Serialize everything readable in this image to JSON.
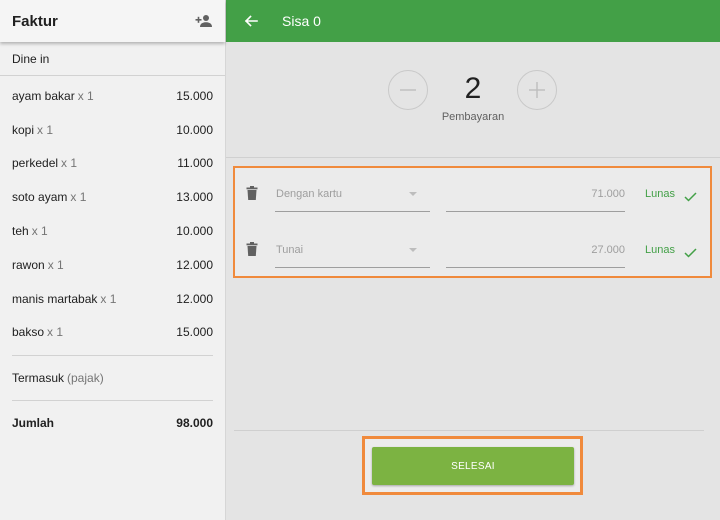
{
  "colors": {
    "topbar": "#43a047",
    "finish_button": "#7cb342",
    "highlight_border": "#f08a3c",
    "paid_status": "#43a047"
  },
  "invoice": {
    "title": "Faktur",
    "add_customer_icon": "person-add-icon",
    "order_type": "Dine in",
    "items": [
      {
        "name": "ayam bakar",
        "qty": "x 1",
        "price": "15.000"
      },
      {
        "name": "kopi",
        "qty": "x 1",
        "price": "10.000"
      },
      {
        "name": "perkedel",
        "qty": "x 1",
        "price": "11.000"
      },
      {
        "name": "soto ayam",
        "qty": "x 1",
        "price": "13.000"
      },
      {
        "name": "teh",
        "qty": "x 1",
        "price": "10.000"
      },
      {
        "name": "rawon",
        "qty": "x 1",
        "price": "12.000"
      },
      {
        "name": "manis martabak",
        "qty": "x 1",
        "price": "12.000"
      },
      {
        "name": "bakso",
        "qty": "x 1",
        "price": "15.000"
      }
    ],
    "tax_label": "Termasuk",
    "tax_note": "(pajak)",
    "total_label": "Jumlah",
    "total_value": "98.000"
  },
  "topbar": {
    "back_icon": "arrow-back-icon",
    "title": "Sisa 0"
  },
  "stepper": {
    "value": "2",
    "label": "Pembayaran"
  },
  "payments": [
    {
      "method": "Dengan kartu",
      "amount": "71.000",
      "status": "Lunas"
    },
    {
      "method": "Tunai",
      "amount": "27.000",
      "status": "Lunas"
    }
  ],
  "finish_label": "SELESAI"
}
